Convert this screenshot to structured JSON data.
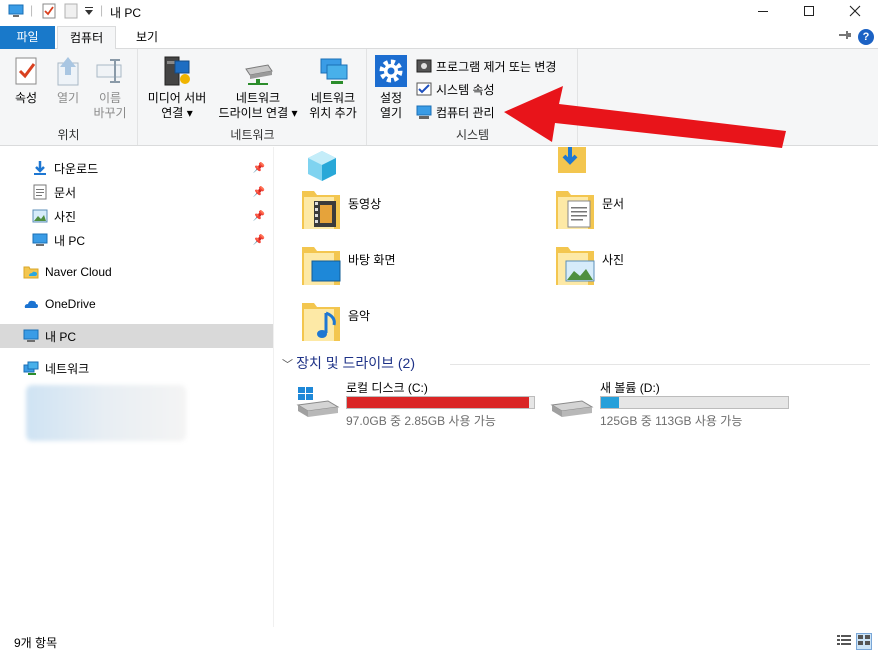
{
  "window": {
    "title": "내 PC",
    "minimize_icon": "minimize-icon",
    "maximize_icon": "maximize-icon",
    "close_icon": "close-icon"
  },
  "tabs": {
    "file": "파일",
    "computer": "컴퓨터",
    "view": "보기"
  },
  "ribbon": {
    "location": {
      "label": "위치",
      "properties": "속성",
      "open": "열기",
      "rename": [
        "이름",
        "바꾸기"
      ]
    },
    "network": {
      "label": "네트워크",
      "media_server": [
        "미디어 서버",
        "연결"
      ],
      "map_drive": [
        "네트워크",
        "드라이브 연결"
      ],
      "add_location": [
        "네트워크",
        "위치 추가"
      ]
    },
    "system": {
      "label": "시스템",
      "open_settings": [
        "설정",
        "열기"
      ],
      "uninstall": "프로그램 제거 또는 변경",
      "system_properties": "시스템 속성",
      "manage": "컴퓨터 관리"
    }
  },
  "sidebar": {
    "quick_access": [
      {
        "label": "다운로드",
        "icon": "download-icon"
      },
      {
        "label": "문서",
        "icon": "document-icon"
      },
      {
        "label": "사진",
        "icon": "pictures-icon"
      },
      {
        "label": "내 PC",
        "icon": "pc-icon"
      }
    ],
    "naver_cloud": "Naver Cloud",
    "onedrive": "OneDrive",
    "this_pc": "내 PC",
    "network": "네트워크"
  },
  "content": {
    "folders": [
      {
        "label": "",
        "icon": "3d-objects-icon"
      },
      {
        "label": "",
        "icon": "downloads-folder-icon"
      },
      {
        "label": "동영상",
        "icon": "videos-folder-icon"
      },
      {
        "label": "문서",
        "icon": "documents-folder-icon"
      },
      {
        "label": "바탕 화면",
        "icon": "desktop-folder-icon"
      },
      {
        "label": "사진",
        "icon": "pictures-folder-icon"
      },
      {
        "label": "음악",
        "icon": "music-folder-icon"
      }
    ],
    "devices_header": "장치 및 드라이브 (2)",
    "drives": [
      {
        "name": "로컬 디스크 (C:)",
        "info": "97.0GB 중 2.85GB 사용 가능",
        "used_fraction": 0.971,
        "bar_color": "#da2626"
      },
      {
        "name": "새 볼륨 (D:)",
        "info": "125GB 중 113GB 사용 가능",
        "used_fraction": 0.096,
        "bar_color": "#26a0da"
      }
    ]
  },
  "status": {
    "item_count": "9개 항목"
  },
  "colors": {
    "accent": "#1979ca",
    "annotation_arrow": "#e8141a"
  }
}
